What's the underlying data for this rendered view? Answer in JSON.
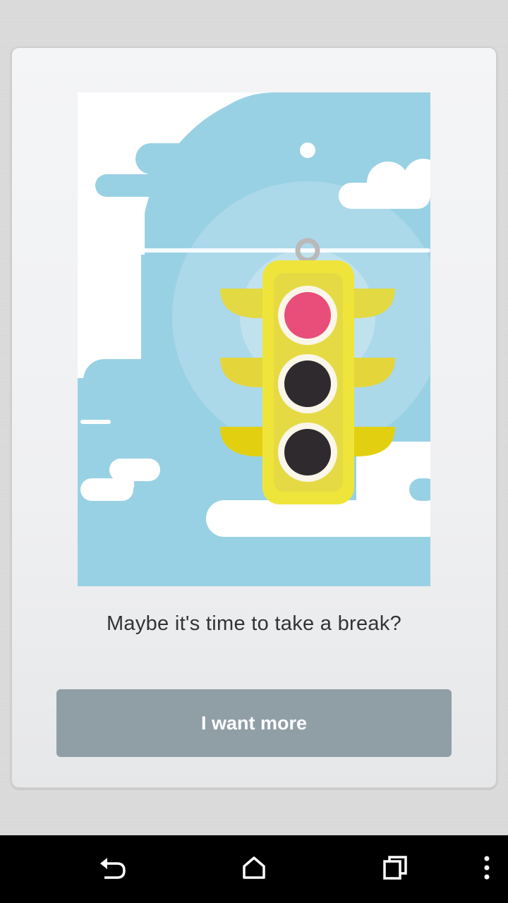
{
  "dialog": {
    "message": "Maybe it's time to take a break?",
    "button_label": "I want more"
  },
  "illustration": {
    "subject": "traffic-light",
    "colors": {
      "sky": "#99d1e4",
      "cloud": "#ffffff",
      "light_body": "#efe53a",
      "red_light": "#e94d79",
      "off_light": "#2f2a2d"
    }
  },
  "navbar": {
    "icons": [
      "back-icon",
      "home-icon",
      "recents-icon",
      "overflow-menu-icon"
    ]
  }
}
